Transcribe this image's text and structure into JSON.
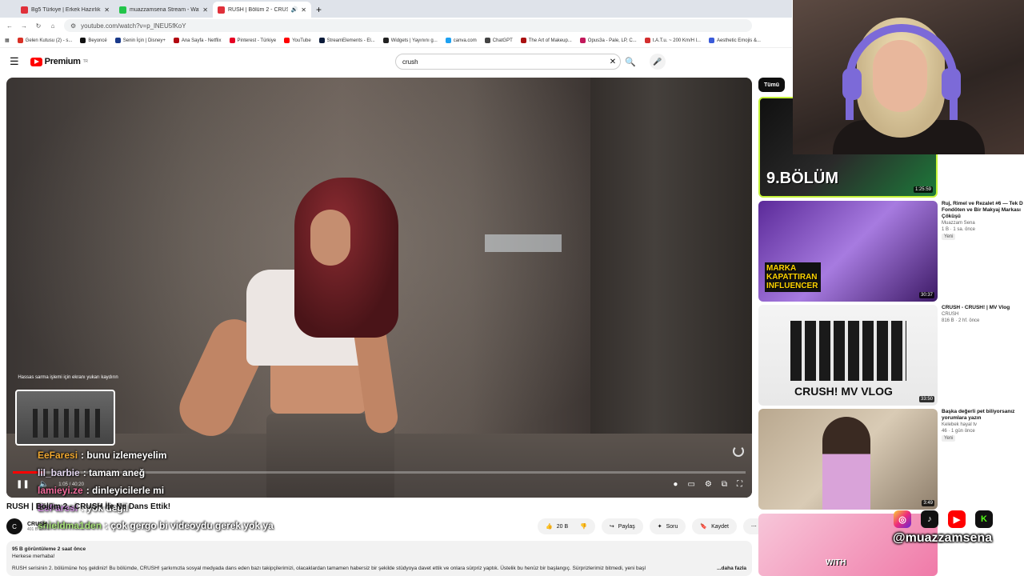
{
  "browser": {
    "tabs": [
      {
        "title": "Bg5 Türkiye | Erkek Hazırlık Se",
        "color": "#e0303a",
        "active": false
      },
      {
        "title": "muazzamsena Stream - Watch",
        "color": "#23c54a",
        "active": false
      },
      {
        "title": "RUSH | Bölüm 2 - CRUSHİ",
        "color": "#e0303a",
        "active": true
      }
    ],
    "new_tab": "+",
    "url": "youtube.com/watch?v=p_lNEU5fKoY",
    "bookmarks": [
      {
        "label": "Gelen Kutusu (2) - s...",
        "color": "#d93025"
      },
      {
        "label": "Beyoncé",
        "color": "#111111"
      },
      {
        "label": "Senin İçin | Disney+",
        "color": "#1a3a8a"
      },
      {
        "label": "Ana Sayfa - Netflix",
        "color": "#b20710"
      },
      {
        "label": "Pinterest - Türkiye",
        "color": "#e60023"
      },
      {
        "label": "YouTube",
        "color": "#ff0000"
      },
      {
        "label": "StreamElements - El...",
        "color": "#0b1b3a"
      },
      {
        "label": "Widgets | Yayınını g...",
        "color": "#222222"
      },
      {
        "label": "canva.com",
        "color": "#1da1f2"
      },
      {
        "label": "ChatGPT",
        "color": "#444444"
      },
      {
        "label": "The Art of Makeup...",
        "color": "#a11"
      },
      {
        "label": "Opus3a - Pale, LP, C...",
        "color": "#c2185b"
      },
      {
        "label": "t.A.T.u. ~ 200 Km/H l...",
        "color": "#d32f2f"
      },
      {
        "label": "Aesthetic Emojis &...",
        "color": "#3a5bd9"
      }
    ]
  },
  "youtube": {
    "logo": "Premium",
    "logo_region": "TR",
    "search_query": "crush",
    "video": {
      "scroll_tip": "Hassas sarma işlemi için ekranı yukarı kaydırın",
      "time": "1:05 / 40:20",
      "title": "RUSH | Bölüm 2 - CRUSH İle Ne Dans Ettik!",
      "channel": "CRUSH",
      "subscribers": "401 B abone",
      "likes": "20 B",
      "share": "Paylaş",
      "ask": "Soru",
      "save": "Kaydet",
      "views": "95 B görüntüleme  2 saat önce",
      "greeting": "Herkese merhaba!",
      "description": "RUSH serisinin 2. bölümüne hoş geldiniz! Bu bölümde, CRUSH! şarkımızla sosyal medyada dans eden bazı takipçilerimizi, olacaklardan tamamen habersiz bir şekilde stüdyoya davet ettik ve onlara sürpriz yaptık. Üstelik bu henüz bir başlangıç. Sürprizlerimiz bitmedi, yeni başl",
      "more": "...daha fazla"
    },
    "chip": "Tümü",
    "recommendations": [
      {
        "title": "",
        "channel": "",
        "meta": "",
        "badge": "",
        "duration": "1:25:59",
        "overlay": "9.BÖLÜM",
        "bg": "#1d7a3a"
      },
      {
        "title": "Ruj, Rimel ve Rezalet #6 — Tek D Fondöten ve Bir Makyaj Markası Çöküşü",
        "channel": "Muazzam Sena",
        "meta": "1 B · 1 sa. önce",
        "badge": "Yeni",
        "duration": "30:37",
        "overlay": "MARKA KAPATTIRAN INFLUENCER",
        "bg": "#7b3fbf"
      },
      {
        "title": "CRUSH - CRUSH! | MV Vlog",
        "channel": "CRUSH",
        "meta": "816 B · 2 hf. önce",
        "badge": "",
        "duration": "33:50",
        "overlay": "CRUSH! MV VLOG",
        "bg": "#f2f2f2"
      },
      {
        "title": "Başka değerli pet biliyorsanız yorumlara yazın",
        "channel": "Kelebek hayal tv",
        "meta": "46 · 1 gün önce",
        "badge": "Yeni",
        "duration": "3:49",
        "overlay": "",
        "bg": "#c9b9a0"
      },
      {
        "title": "",
        "channel": "",
        "meta": "",
        "badge": "",
        "duration": "",
        "overlay": "WITH",
        "bg": "#f4a7c6"
      }
    ]
  },
  "stream": {
    "chat": [
      {
        "user": "EeFaresi",
        "msg": ": bunu izlemeyelim"
      },
      {
        "user": "lil_barbie",
        "msg": ": tamam aneğ"
      },
      {
        "user": "lamieyi.ze",
        "msg": ": dinleyicilerle mi"
      },
      {
        "user": "EeFaresi",
        "msg": ": yok değil"
      },
      {
        "user": "shieldma1den",
        "msg": ": çok gergo bi videoydu gerek yok ya"
      }
    ],
    "handle": "@muazzamsena",
    "social_icons": [
      "instagram-icon",
      "tiktok-icon",
      "youtube-icon",
      "kick-icon"
    ]
  }
}
